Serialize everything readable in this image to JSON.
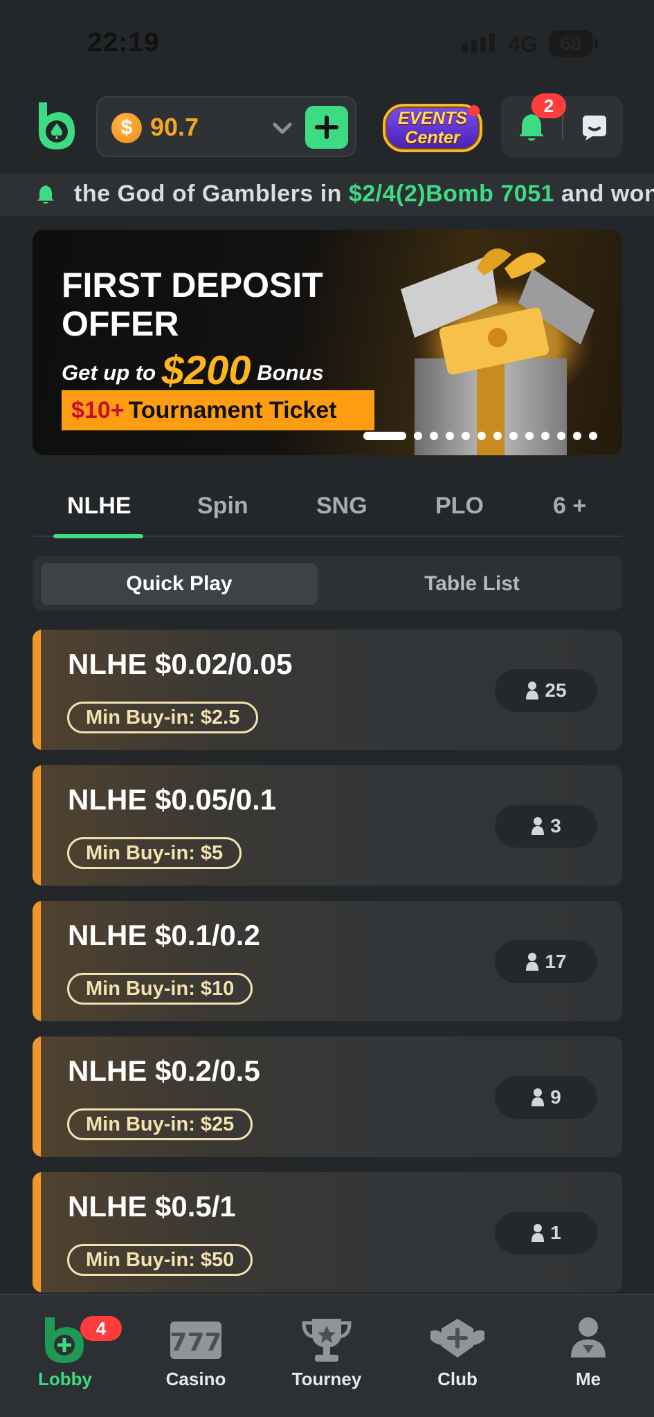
{
  "status_bar": {
    "time": "22:19",
    "network": "4G",
    "battery": "68"
  },
  "header": {
    "balance": "90.7",
    "coin_symbol": "$",
    "events_line1": "EVENTS",
    "events_line2": "Center",
    "notification_count": "2"
  },
  "ticker": {
    "text_before": "the God of Gamblers in ",
    "highlight": "$2/4(2)Bomb 7051",
    "text_after": " and won"
  },
  "banner": {
    "title_line1": "FIRST DEPOSIT",
    "title_line2": "OFFER",
    "get_up_to": "Get up to ",
    "amount": "$200",
    "bonus": " Bonus",
    "ticket_highlight": "$10+",
    "ticket_text": "Tournament Ticket",
    "slide_count": 13,
    "active_slide": 1
  },
  "game_tabs": [
    {
      "label": "NLHE",
      "active": true
    },
    {
      "label": "Spin",
      "active": false
    },
    {
      "label": "SNG",
      "active": false
    },
    {
      "label": "PLO",
      "active": false
    },
    {
      "label": "6 +",
      "active": false
    }
  ],
  "mode_toggle": {
    "quick_play": "Quick Play",
    "table_list": "Table List",
    "selected": "Quick Play"
  },
  "tables": [
    {
      "title": "NLHE $0.02/0.05",
      "min_buyin": "Min Buy-in: $2.5",
      "players": "25"
    },
    {
      "title": "NLHE $0.05/0.1",
      "min_buyin": "Min Buy-in: $5",
      "players": "3"
    },
    {
      "title": "NLHE $0.1/0.2",
      "min_buyin": "Min Buy-in: $10",
      "players": "17"
    },
    {
      "title": "NLHE $0.2/0.5",
      "min_buyin": "Min Buy-in: $25",
      "players": "9"
    },
    {
      "title": "NLHE $0.5/1",
      "min_buyin": "Min Buy-in: $50",
      "players": "1"
    }
  ],
  "bottom_nav": [
    {
      "label": "Lobby",
      "active": true,
      "icon": "lobby-icon",
      "badge": "4"
    },
    {
      "label": "Casino",
      "active": false,
      "icon": "casino-icon"
    },
    {
      "label": "Tourney",
      "active": false,
      "icon": "trophy-icon"
    },
    {
      "label": "Club",
      "active": false,
      "icon": "club-icon"
    },
    {
      "label": "Me",
      "active": false,
      "icon": "profile-icon"
    }
  ],
  "colors": {
    "accent_green": "#3ddc84",
    "accent_orange": "#f0962a",
    "balance_gold": "#f6a623",
    "badge_red": "#ff3d3d"
  }
}
